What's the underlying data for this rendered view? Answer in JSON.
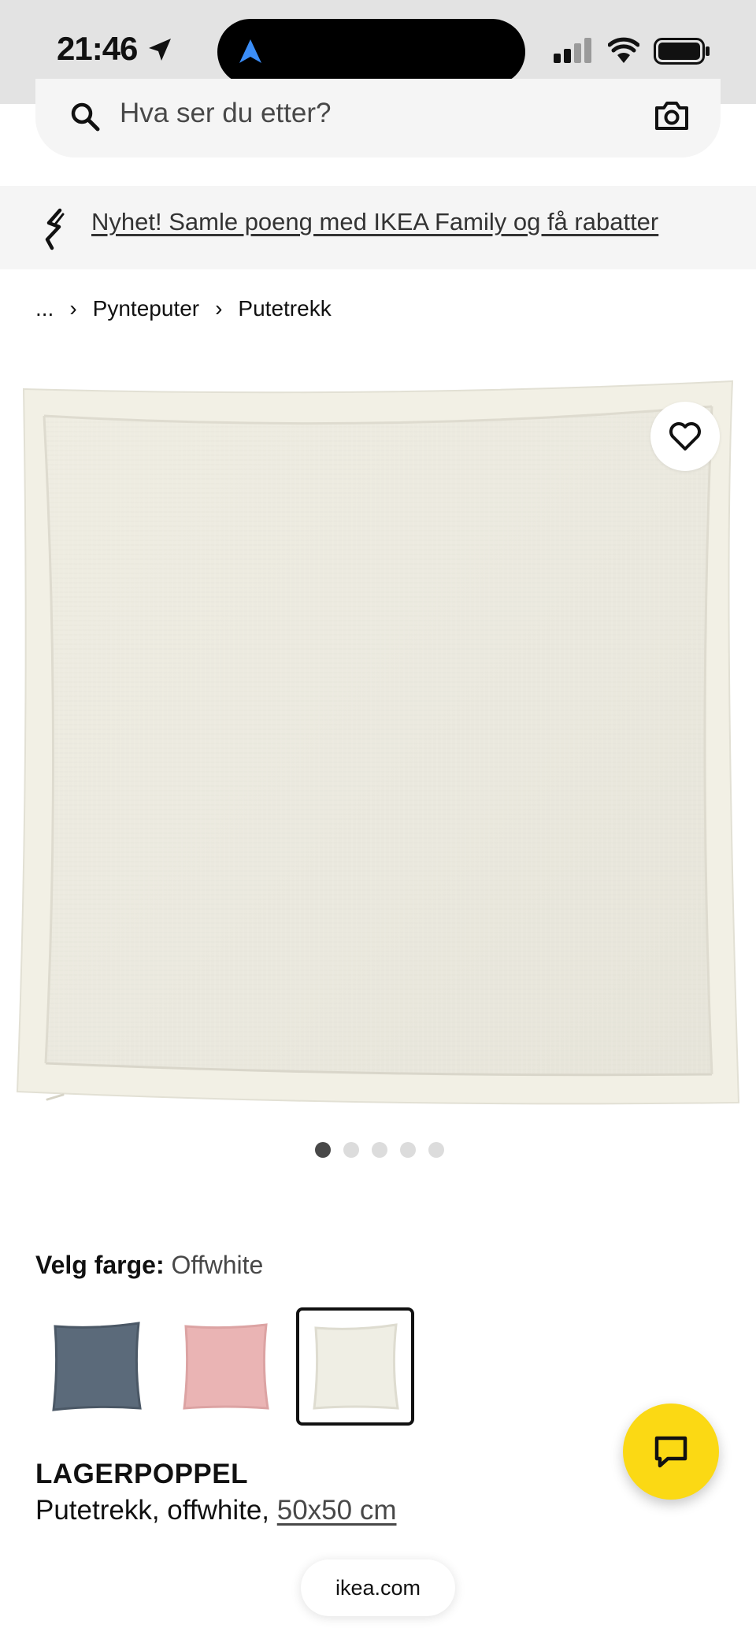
{
  "status_bar": {
    "time": "21:46",
    "icons": [
      "location-arrow-icon",
      "maps-navigation-icon",
      "cellular-signal-icon",
      "wifi-icon",
      "battery-icon"
    ]
  },
  "search": {
    "placeholder": "Hva ser du etter?",
    "icons": [
      "search-icon",
      "camera-icon"
    ]
  },
  "promo": {
    "text": "Nyhet! Samle poeng med IKEA Family og få rabatter",
    "icon": "ikea-family-icon"
  },
  "breadcrumb": {
    "items": [
      "...",
      "Pynteputer",
      "Putetrekk"
    ],
    "separator": "›"
  },
  "gallery": {
    "image_count": 5,
    "active_index": 0,
    "favorite_icon": "heart-icon"
  },
  "color_selector": {
    "label": "Velg farge:",
    "selected": "Offwhite",
    "swatches": [
      {
        "name": "blue-grey",
        "color": "#5b6a7a",
        "selected": false
      },
      {
        "name": "pink",
        "color": "#eab4b4",
        "selected": false
      },
      {
        "name": "offwhite",
        "color": "#efeee4",
        "selected": true
      }
    ]
  },
  "product": {
    "name": "LAGERPOPPEL",
    "description": "Putetrekk, offwhite,",
    "size": "50x50 cm"
  },
  "chat": {
    "icon": "chat-icon",
    "color": "#fbd914"
  },
  "browser": {
    "url": "ikea.com"
  },
  "colors": {
    "status_bar_bg": "#e3e3e3",
    "accent_yellow": "#fbd914",
    "island_blue": "#3b8df7"
  }
}
